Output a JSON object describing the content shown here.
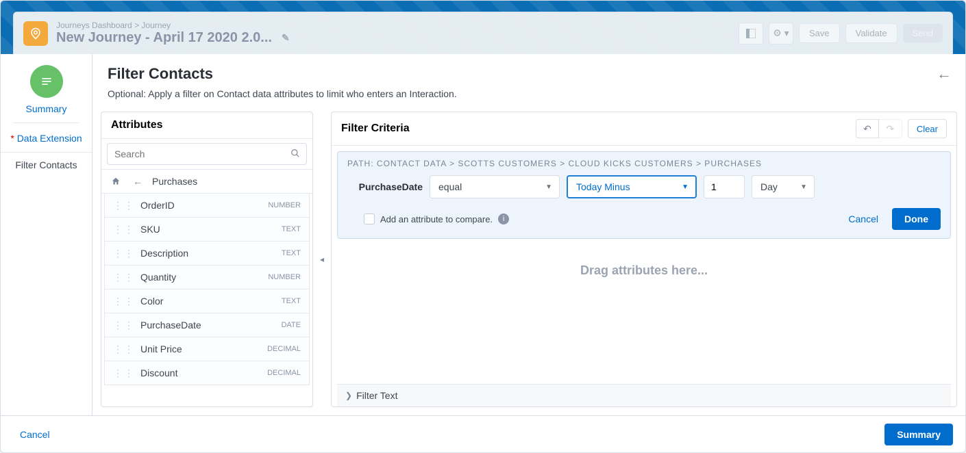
{
  "header": {
    "breadcrumb_a": "Journeys Dashboard",
    "breadcrumb_b": "Journey",
    "title": "New Journey - April 17 2020 2.0...",
    "save": "Save",
    "validate": "Validate",
    "send": "Send"
  },
  "nav": {
    "summary": "Summary",
    "data_ext": "Data Extension",
    "filter": "Filter Contacts"
  },
  "main": {
    "title": "Filter Contacts",
    "subtitle": "Optional: Apply a filter on Contact data attributes to limit who enters an Interaction."
  },
  "attributes": {
    "title": "Attributes",
    "search_placeholder": "Search",
    "breadcrumb": "Purchases",
    "items": [
      {
        "name": "OrderID",
        "type": "NUMBER"
      },
      {
        "name": "SKU",
        "type": "TEXT"
      },
      {
        "name": "Description",
        "type": "TEXT"
      },
      {
        "name": "Quantity",
        "type": "NUMBER"
      },
      {
        "name": "Color",
        "type": "TEXT"
      },
      {
        "name": "PurchaseDate",
        "type": "DATE"
      },
      {
        "name": "Unit Price",
        "type": "DECIMAL"
      },
      {
        "name": "Discount",
        "type": "DECIMAL"
      }
    ]
  },
  "criteria": {
    "title": "Filter Criteria",
    "clear": "Clear",
    "path_label": "PATH:",
    "path_parts": [
      "CONTACT DATA",
      "SCOTTS CUSTOMERS",
      "CLOUD KICKS CUSTOMERS",
      "PURCHASES"
    ],
    "rule_attr": "PurchaseDate",
    "operator": "equal",
    "relative": "Today Minus",
    "value": "1",
    "unit": "Day",
    "compare_label": "Add an attribute to compare.",
    "cancel": "Cancel",
    "done": "Done",
    "dropzone": "Drag attributes here...",
    "filter_text": "Filter Text"
  },
  "footer": {
    "cancel": "Cancel",
    "summary": "Summary"
  }
}
